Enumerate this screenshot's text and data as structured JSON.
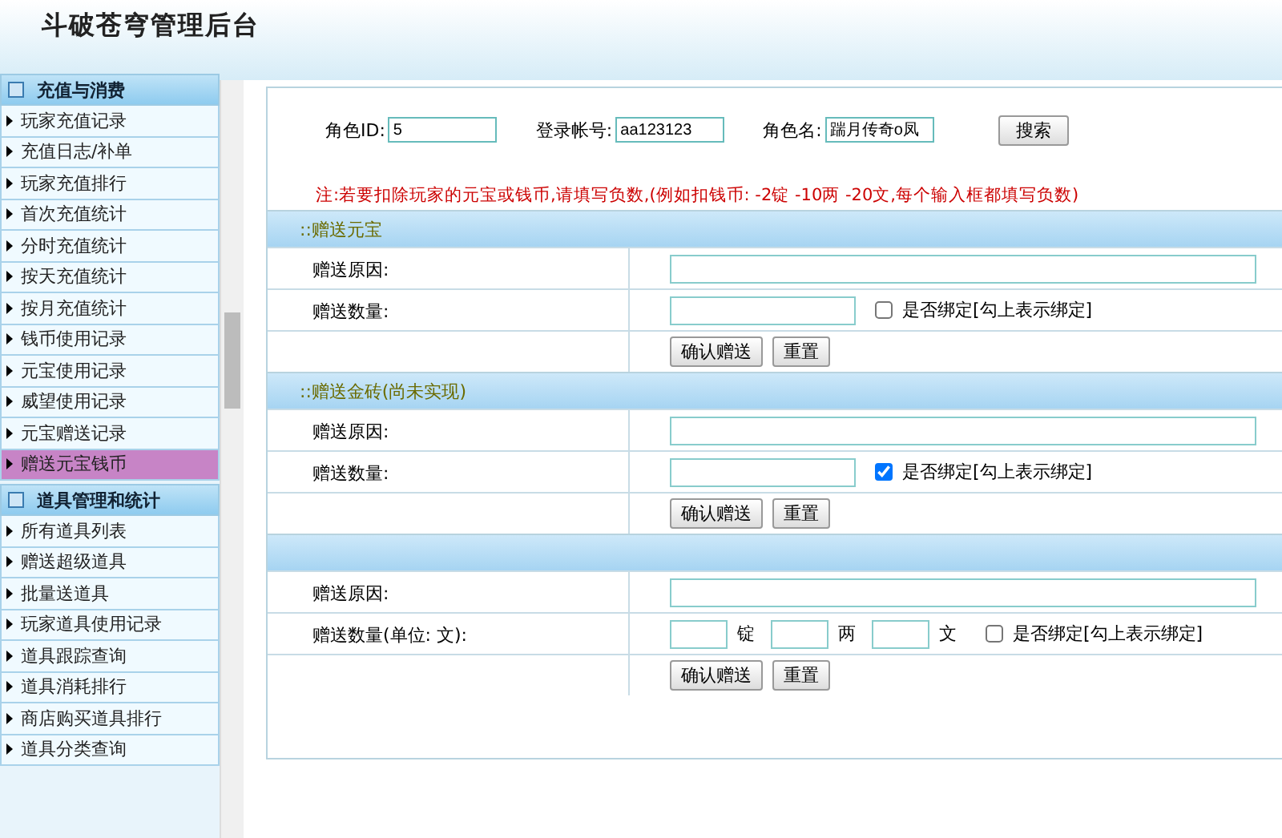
{
  "header": {
    "title": "斗破苍穹管理后台"
  },
  "sidebar": {
    "groups": [
      {
        "title": "充值与消费",
        "items": [
          {
            "label": "玩家充值记录",
            "selected": false
          },
          {
            "label": "充值日志/补单",
            "selected": false
          },
          {
            "label": "玩家充值排行",
            "selected": false
          },
          {
            "label": "首次充值统计",
            "selected": false
          },
          {
            "label": "分时充值统计",
            "selected": false
          },
          {
            "label": "按天充值统计",
            "selected": false
          },
          {
            "label": "按月充值统计",
            "selected": false
          },
          {
            "label": "钱币使用记录",
            "selected": false
          },
          {
            "label": "元宝使用记录",
            "selected": false
          },
          {
            "label": "威望使用记录",
            "selected": false
          },
          {
            "label": "元宝赠送记录",
            "selected": false
          },
          {
            "label": "赠送元宝钱币",
            "selected": true
          }
        ]
      },
      {
        "title": "道具管理和统计",
        "items": [
          {
            "label": "所有道具列表",
            "selected": false
          },
          {
            "label": "赠送超级道具",
            "selected": false
          },
          {
            "label": "批量送道具",
            "selected": false
          },
          {
            "label": "玩家道具使用记录",
            "selected": false
          },
          {
            "label": "道具跟踪查询",
            "selected": false
          },
          {
            "label": "道具消耗排行",
            "selected": false
          },
          {
            "label": "商店购买道具排行",
            "selected": false
          },
          {
            "label": "道具分类查询",
            "selected": false
          }
        ]
      }
    ]
  },
  "search": {
    "fields": [
      {
        "label": "角色ID:",
        "value": "5"
      },
      {
        "label": "登录帐号:",
        "value": "aa123123"
      },
      {
        "label": "角色名:",
        "value": "踹月传奇o凤"
      }
    ],
    "button": "搜索"
  },
  "note": "注:若要扣除玩家的元宝或钱币,请填写负数,(例如扣钱币: -2锭 -10两 -20文,每个输入框都填写负数)",
  "sections": [
    {
      "title": "::赠送元宝",
      "rows": [
        {
          "kind": "text",
          "label": "赠送原因:"
        },
        {
          "kind": "amount",
          "label": "赠送数量:",
          "checkbox": "是否绑定[勾上表示绑定]",
          "checked": false
        },
        {
          "kind": "buttons",
          "buttons": [
            "确认赠送",
            "重置"
          ]
        }
      ]
    },
    {
      "title": "::赠送金砖(尚未实现)",
      "rows": [
        {
          "kind": "text",
          "label": "赠送原因:"
        },
        {
          "kind": "amount",
          "label": "赠送数量:",
          "checkbox": "是否绑定[勾上表示绑定]",
          "checked": true
        },
        {
          "kind": "buttons",
          "buttons": [
            "确认赠送",
            "重置"
          ]
        }
      ]
    },
    {
      "rows": [
        {
          "kind": "text",
          "label": "赠送原因:"
        },
        {
          "kind": "currency",
          "label": "赠送数量(单位: 文):",
          "units": [
            "锭",
            "两",
            "文"
          ],
          "checkbox": "是否绑定[勾上表示绑定]",
          "checked": false
        },
        {
          "kind": "buttons",
          "buttons": [
            "确认赠送",
            "重置"
          ]
        }
      ]
    }
  ]
}
